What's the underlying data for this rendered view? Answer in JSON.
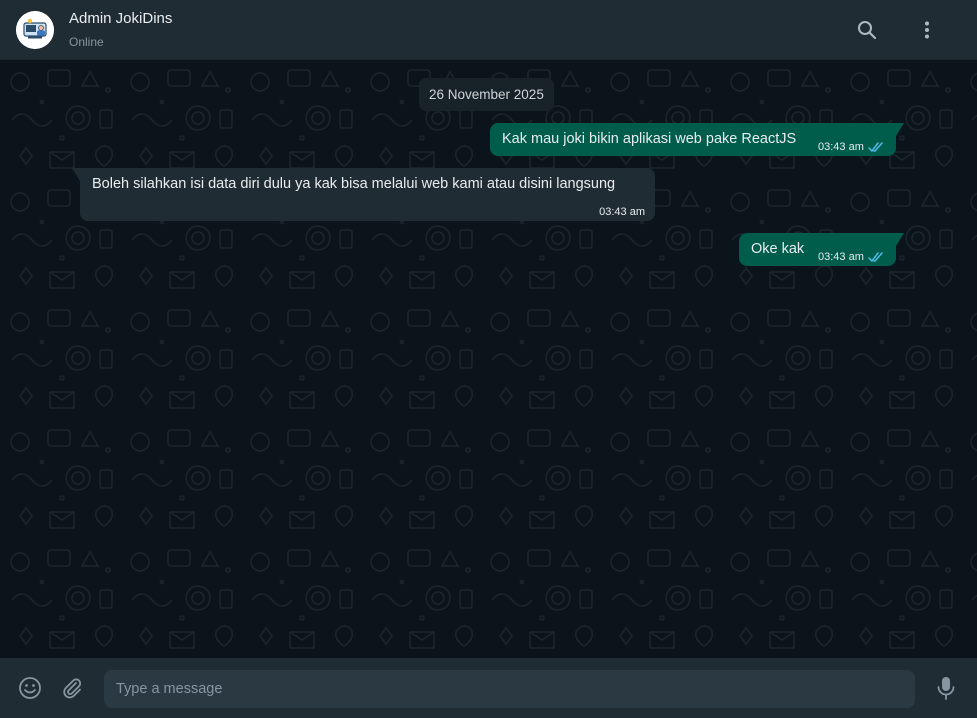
{
  "header": {
    "contact_name": "Admin JokiDins",
    "status": "Online",
    "avatar_icon": "admin-avatar-illustration",
    "search_icon": "search-icon",
    "menu_icon": "kebab-menu-icon"
  },
  "chat": {
    "date_chip": "26 November 2025",
    "messages": [
      {
        "direction": "out",
        "text": "Kak mau joki bikin aplikasi web pake ReactJS",
        "time": "03:43 am",
        "status": "read"
      },
      {
        "direction": "in",
        "text": "Boleh silahkan isi data diri dulu ya kak bisa melalui web kami atau disini langsung",
        "time": "03:43 am"
      },
      {
        "direction": "out",
        "text": "Oke kak",
        "time": "03:43 am",
        "status": "read"
      }
    ]
  },
  "composer": {
    "placeholder": "Type a message",
    "value": "",
    "emoji_icon": "emoji-icon",
    "attach_icon": "paperclip-icon",
    "mic_icon": "microphone-icon"
  },
  "colors": {
    "header_bg": "#202c33",
    "chat_bg": "#0b141a",
    "outgoing_bubble": "#005c4b",
    "incoming_bubble": "#202c33",
    "read_tick": "#53bdeb",
    "muted_text": "#8696a0"
  }
}
